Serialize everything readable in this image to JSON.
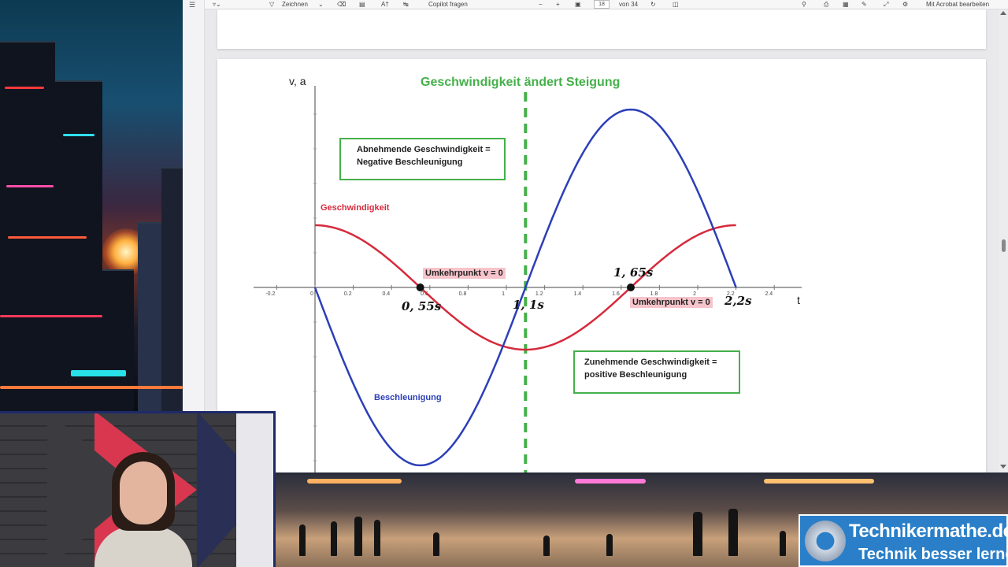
{
  "toolbar": {
    "draw_label": "Zeichnen",
    "copilot_label": "Copilot fragen",
    "page_current": "18",
    "page_of": "von 34",
    "acrobat_label": "Mit Acrobat bearbeiten"
  },
  "document": {
    "heading": "Geschwindigkeit ändert Steigung",
    "box_decreasing": [
      "Abnehmende Geschwindigkeit =",
      "Negative Beschleunigung"
    ],
    "box_increasing": [
      "Zunehmende Geschwindigkeit =",
      "positive Beschleunigung"
    ],
    "turning_point_label": "Umkehrpunkt v = 0",
    "curve_velocity": "Geschwindigkeit",
    "curve_acceleration": "Beschleunigung",
    "marker_labels": [
      "0, 55s",
      "1, 1s",
      "1, 65s",
      "2,2s"
    ]
  },
  "chart_data": {
    "type": "line",
    "xlabel": "t",
    "ylabel": "v, a",
    "xlim": [
      -0.2,
      2.6
    ],
    "x_ticks": [
      "-0.2",
      "0",
      "0.2",
      "0.4",
      "0.6",
      "0.8",
      "1",
      "1.2",
      "1.4",
      "1.6",
      "1.8",
      "2",
      "2.2",
      "2.4"
    ],
    "series": [
      {
        "name": "Geschwindigkeit",
        "color": "#d62a3c",
        "function": "cos",
        "amplitude": 1,
        "period": 2.2,
        "t_range": [
          0,
          2.2
        ]
      },
      {
        "name": "Beschleunigung",
        "color": "#2c3fb8",
        "function": "-sin",
        "amplitude": 2.86,
        "period": 2.2,
        "t_range": [
          0,
          2.2
        ]
      }
    ],
    "points": [
      0.55,
      1.65
    ],
    "vline_t": 1.1,
    "vline_color": "#45b04a"
  },
  "colors": {
    "accent_green": "#45b04a",
    "velocity_red": "#d62a3c",
    "acceleration_blue": "#2c3fb8",
    "turning_pink": "#f7c4cc"
  },
  "branding": {
    "line1": "Technikermathe.de",
    "line2": "Technik besser lernen"
  }
}
